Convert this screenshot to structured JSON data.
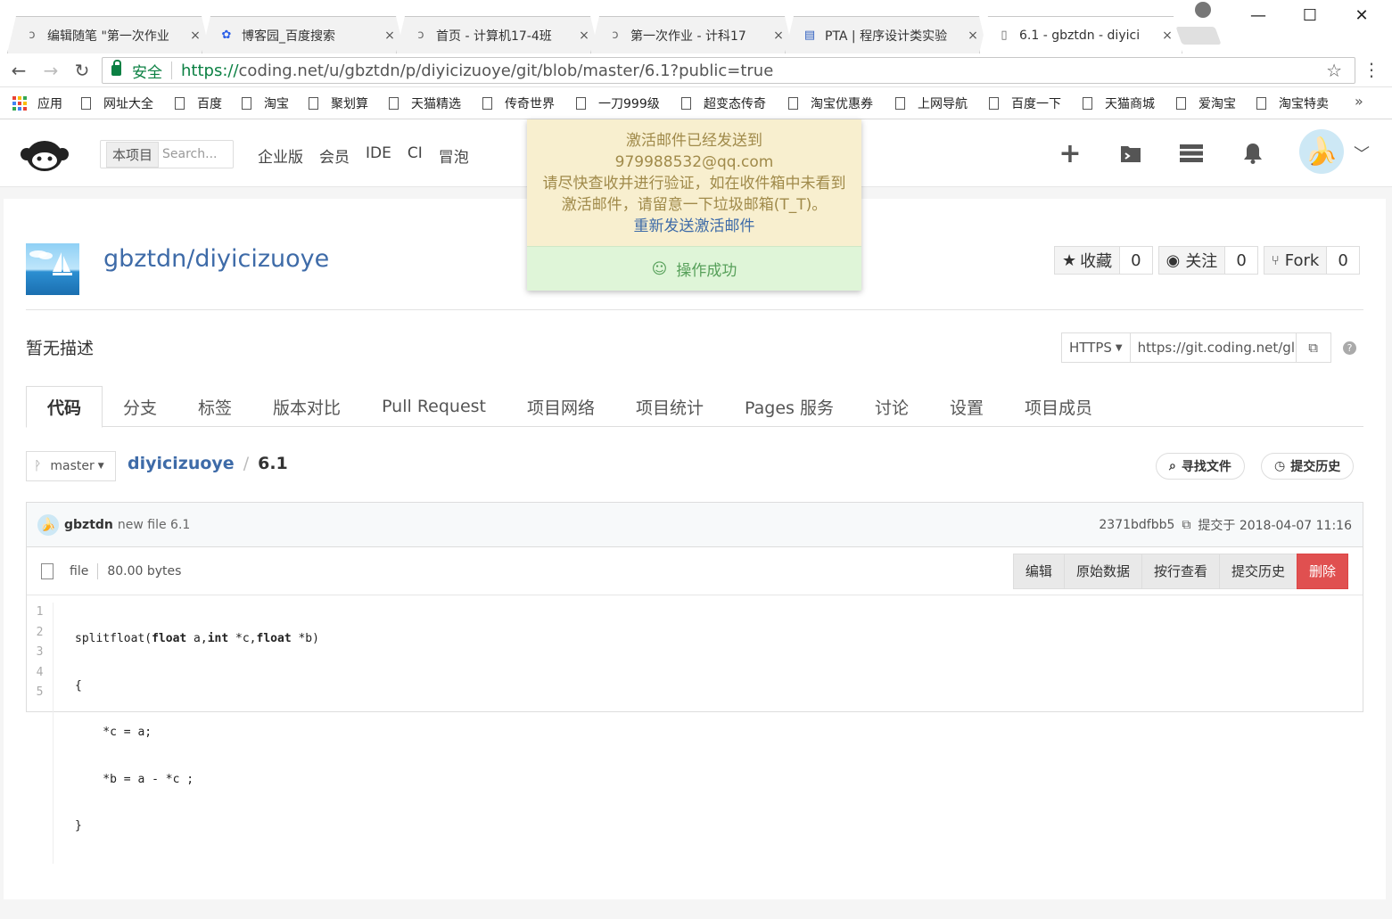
{
  "browser": {
    "tabs": [
      {
        "title": "编辑随笔 \"第一次作业",
        "icon": "spiral-icon",
        "active": false
      },
      {
        "title": "博客园_百度搜索",
        "icon": "paw-icon",
        "active": false
      },
      {
        "title": "首页 - 计算机17-4班",
        "icon": "spiral-icon",
        "active": false
      },
      {
        "title": "第一次作业 - 计科17",
        "icon": "spiral-icon",
        "active": false
      },
      {
        "title": "PTA | 程序设计类实验",
        "icon": "pta-icon",
        "active": false
      },
      {
        "title": "6.1 - gbztdn - diyici",
        "icon": "doc-icon",
        "active": true
      }
    ],
    "close_glyph": "×",
    "window": {
      "minimize": "—",
      "maximize": "☐",
      "close": "✕"
    },
    "address": {
      "secure_label": "安全",
      "url_scheme": "https://",
      "url_rest": "coding.net/u/gbztdn/p/diyicizuoye/git/blob/master/6.1?public=true"
    },
    "bookmarks": [
      "应用",
      "网址大全",
      "百度",
      "淘宝",
      "聚划算",
      "天猫精选",
      "传奇世界",
      "一刀999级",
      "超变态传奇",
      "淘宝优惠券",
      "上网导航",
      "百度一下",
      "天猫商城",
      "爱淘宝",
      "淘宝特卖"
    ],
    "bookmarks_more": "»"
  },
  "header": {
    "search_scope": "本项目",
    "search_placeholder": "Search...",
    "nav": [
      "企业版",
      "会员",
      "IDE",
      "CI",
      "冒泡"
    ]
  },
  "notice": {
    "line1": "激活邮件已经发送到",
    "line2": "979988532@qq.com",
    "line3": "请尽快查收并进行验证，如在收件箱中未看到",
    "line4": "激活邮件，请留意一下垃圾邮箱(T_T)。",
    "resend": "重新发送激活邮件",
    "success": "操作成功"
  },
  "repo": {
    "name": "gbztdn/diyicizuoye",
    "star_label": "收藏",
    "star_count": "0",
    "watch_label": "关注",
    "watch_count": "0",
    "fork_label": "Fork",
    "fork_count": "0",
    "description": "暂无描述",
    "clone_protocol": "HTTPS",
    "clone_url": "https://git.coding.net/gl",
    "tabs": [
      "代码",
      "分支",
      "标签",
      "版本对比",
      "Pull Request",
      "项目网络",
      "项目统计",
      "Pages 服务",
      "讨论",
      "设置",
      "项目成员"
    ]
  },
  "file": {
    "branch": "master",
    "crumb_repo": "diyicizuoye",
    "crumb_file": "6.1",
    "find_file": "寻找文件",
    "history": "提交历史",
    "commit_author": "gbztdn",
    "commit_message": "new file 6.1",
    "commit_hash": "2371bdfbb5",
    "commit_time": "提交于 2018-04-07 11:16",
    "type": "file",
    "size": "80.00 bytes",
    "actions": {
      "edit": "编辑",
      "raw": "原始数据",
      "blame": "按行查看",
      "history": "提交历史",
      "delete": "删除"
    },
    "line_numbers": [
      "1",
      "2",
      "3",
      "4",
      "5"
    ]
  }
}
